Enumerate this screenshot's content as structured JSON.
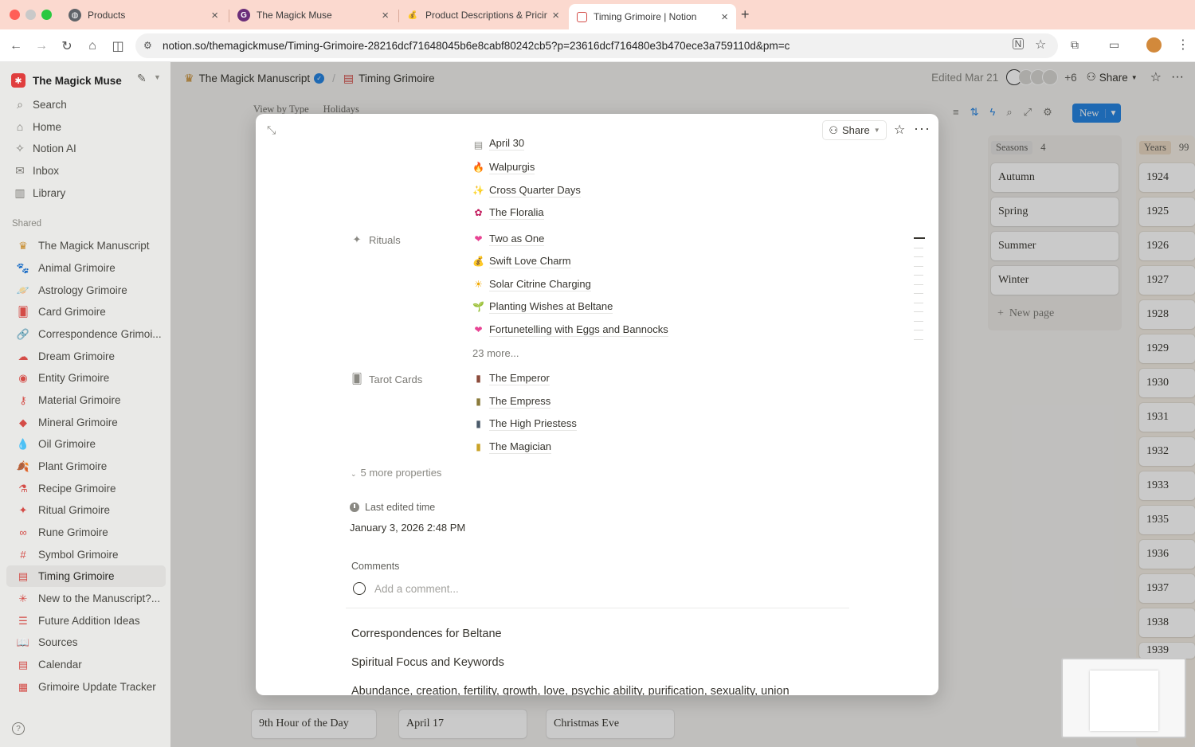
{
  "browser": {
    "tabs": [
      {
        "label": "Products",
        "icon": "globe-icon"
      },
      {
        "label": "The Magick Muse",
        "icon": "g-logo-icon"
      },
      {
        "label": "Product Descriptions & Pricin",
        "icon": "money-bag-icon"
      },
      {
        "label": "Timing Grimoire | Notion",
        "icon": "calendar-icon"
      }
    ],
    "url": "notion.so/themagickmuse/Timing-Grimoire-28216dcf71648045b6e8cabf80242cb5?p=23616dcf716480e3b470ece3a759110d&pm=c"
  },
  "sidebar": {
    "workspace": "The Magick Muse",
    "top_items": [
      {
        "label": "Search",
        "icon": "search-icon"
      },
      {
        "label": "Home",
        "icon": "home-icon"
      },
      {
        "label": "Notion AI",
        "icon": "ai-icon"
      },
      {
        "label": "Inbox",
        "icon": "inbox-icon"
      },
      {
        "label": "Library",
        "icon": "library-icon"
      }
    ],
    "section_label": "Shared",
    "items": [
      {
        "label": "The Magick Manuscript",
        "icon": "crown-icon"
      },
      {
        "label": "Animal Grimoire",
        "icon": "animal-icon"
      },
      {
        "label": "Astrology Grimoire",
        "icon": "planet-icon"
      },
      {
        "label": "Card Grimoire",
        "icon": "cards-icon"
      },
      {
        "label": "Correspondence Grimoi...",
        "icon": "link-icon"
      },
      {
        "label": "Dream Grimoire",
        "icon": "cloud-icon"
      },
      {
        "label": "Entity Grimoire",
        "icon": "eye-icon"
      },
      {
        "label": "Material Grimoire",
        "icon": "key-icon"
      },
      {
        "label": "Mineral Grimoire",
        "icon": "gem-icon"
      },
      {
        "label": "Oil Grimoire",
        "icon": "drop-icon"
      },
      {
        "label": "Plant Grimoire",
        "icon": "leaf-icon"
      },
      {
        "label": "Recipe Grimoire",
        "icon": "flask-icon"
      },
      {
        "label": "Ritual Grimoire",
        "icon": "wand-icon"
      },
      {
        "label": "Rune Grimoire",
        "icon": "infinity-icon"
      },
      {
        "label": "Symbol Grimoire",
        "icon": "hash-icon"
      },
      {
        "label": "Timing Grimoire",
        "icon": "calendar-icon",
        "selected": true
      },
      {
        "label": "New to the Manuscript?...",
        "icon": "sparkle-icon"
      },
      {
        "label": "Future Addition Ideas",
        "icon": "list-icon"
      },
      {
        "label": "Sources",
        "icon": "book-icon"
      },
      {
        "label": "Calendar",
        "icon": "calendar-icon"
      },
      {
        "label": "Grimoire Update Tracker",
        "icon": "table-icon"
      }
    ]
  },
  "topbar": {
    "crumb1": "The Magick Manuscript",
    "crumb2": "Timing Grimoire",
    "edited": "Edited Mar 21",
    "extra_count": "+6",
    "share": "Share"
  },
  "database": {
    "views": [
      "View by Type",
      "Holidays"
    ],
    "new_label": "New",
    "columns": [
      {
        "name": "Seasons",
        "count": "4",
        "cards": [
          "Autumn",
          "Spring",
          "Summer",
          "Winter"
        ]
      },
      {
        "name": "Years",
        "count": "99",
        "cards": [
          "1924",
          "1925",
          "1926",
          "1927",
          "1928",
          "1929",
          "1930",
          "1931",
          "1932",
          "1933",
          "1935",
          "1936",
          "1937",
          "1938",
          "1939"
        ]
      }
    ],
    "new_page": "New page",
    "bottom_cards": [
      "9th Hour of the Day",
      "April 17",
      "Christmas Eve"
    ]
  },
  "modal": {
    "share": "Share",
    "holidays_partial": [
      {
        "label": "April 30",
        "icon": "calendar-icon"
      },
      {
        "label": "Walpurgis",
        "icon": "fire-icon"
      },
      {
        "label": "Cross Quarter Days",
        "icon": "sparkles-icon"
      },
      {
        "label": "The Floralia",
        "icon": "flower-icon"
      }
    ],
    "rituals_label": "Rituals",
    "rituals": [
      {
        "label": "Two as One",
        "icon": "heart-icon"
      },
      {
        "label": "Swift Love Charm",
        "icon": "money-bag-icon"
      },
      {
        "label": "Solar Citrine Charging",
        "icon": "sun-icon"
      },
      {
        "label": "Planting Wishes at Beltane",
        "icon": "seedling-icon"
      },
      {
        "label": "Fortunetelling with Eggs and Bannocks",
        "icon": "heart-icon"
      }
    ],
    "rituals_more": "23 more...",
    "tarot_label": "Tarot Cards",
    "tarot": [
      {
        "label": "The Emperor",
        "icon": "tarot-card-icon"
      },
      {
        "label": "The Empress",
        "icon": "tarot-card-icon"
      },
      {
        "label": "The High Priestess",
        "icon": "tarot-card-icon"
      },
      {
        "label": "The Magician",
        "icon": "tarot-card-icon"
      }
    ],
    "more_properties": "5 more properties",
    "last_edited_label": "Last edited time",
    "last_edited_value": "January 3, 2026 2:48 PM",
    "comments_label": "Comments",
    "comment_placeholder": "Add a comment...",
    "body": [
      "Correspondences for Beltane",
      "Spiritual Focus and Keywords",
      "Abundance, creation, fertility, growth, love, psychic ability, purification, sexuality, union"
    ]
  }
}
